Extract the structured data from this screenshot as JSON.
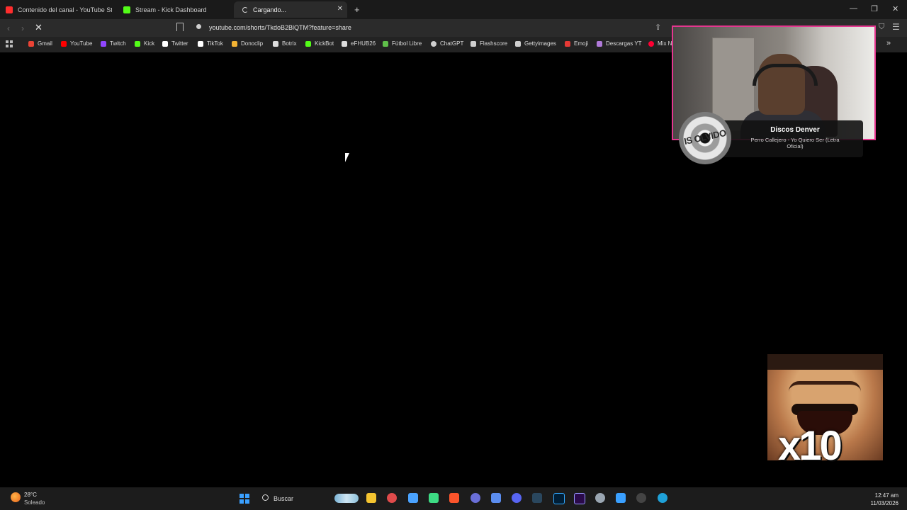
{
  "tabs": [
    {
      "title": "Contenido del canal - YouTube Studio",
      "favicon_color": "#ff2d2d"
    },
    {
      "title": "Stream - Kick Dashboard",
      "favicon_color": "#53fc18"
    },
    {
      "title": "Cargando...",
      "favicon_color": "#cfcfcf",
      "active": true
    }
  ],
  "toolbar": {
    "url": "youtube.com/shorts/TkdoB2BlQTM?feature=share"
  },
  "bookmarks": [
    {
      "label": "Gmail",
      "color": "#ea4335"
    },
    {
      "label": "YouTube",
      "color": "#ff0000"
    },
    {
      "label": "Twitch",
      "color": "#9146ff"
    },
    {
      "label": "Kick",
      "color": "#53fc18"
    },
    {
      "label": "Twitter",
      "color": "#ffffff"
    },
    {
      "label": "TikTok",
      "color": "#ffffff"
    },
    {
      "label": "Donoclip",
      "color": "#f2b233"
    },
    {
      "label": "Botrix",
      "color": "#dddddd"
    },
    {
      "label": "KickBot",
      "color": "#53fc18"
    },
    {
      "label": "eFHUB26",
      "color": "#dddddd"
    },
    {
      "label": "Fútbol Libre",
      "color": "#5fbf4a"
    },
    {
      "label": "ChatGPT",
      "color": "#cfcfcf"
    },
    {
      "label": "Flashscore",
      "color": "#cfcfcf"
    },
    {
      "label": "Gettyimages",
      "color": "#cfcfcf"
    },
    {
      "label": "Emoji",
      "color": "#e53935"
    },
    {
      "label": "Descargas YT",
      "color": "#b07ad9"
    },
    {
      "label": "Mix N",
      "color": "#ff0033"
    }
  ],
  "now_playing": {
    "title": "Discos Denver",
    "subtitle": "Perro Callejero - Yo Quiero Ser (Letra Oficial)",
    "vinyl_text": "IS OLVIDO"
  },
  "meme": {
    "caption": "x10"
  },
  "taskbar": {
    "weather_temp": "28°C",
    "weather_condition": "Soleado",
    "search_label": "Buscar",
    "time": "12:47 am",
    "date": "11/03/2026",
    "apps": [
      {
        "name": "file-explorer-icon",
        "color": "#f4c430"
      },
      {
        "name": "cleaner-icon",
        "color": "#e04b4b"
      },
      {
        "name": "app-icon-3",
        "color": "#4aa3ff"
      },
      {
        "name": "app-icon-4",
        "color": "#3ddc84"
      },
      {
        "name": "brave-icon",
        "color": "#fb542b"
      },
      {
        "name": "app-icon-6",
        "color": "#6a6fd8"
      },
      {
        "name": "calculator-icon",
        "color": "#5b8def"
      },
      {
        "name": "discord-icon",
        "color": "#5865f2"
      },
      {
        "name": "steam-icon",
        "color": "#2a475e"
      },
      {
        "name": "photoshop-icon",
        "color": "#001e36"
      },
      {
        "name": "premiere-icon",
        "color": "#2a0a4a"
      },
      {
        "name": "settings-icon",
        "color": "#9aa6b2"
      },
      {
        "name": "notepad-icon",
        "color": "#3aa0ff"
      },
      {
        "name": "media-player-icon",
        "color": "#444444"
      },
      {
        "name": "edge-icon",
        "color": "#1fa1d8"
      }
    ]
  }
}
